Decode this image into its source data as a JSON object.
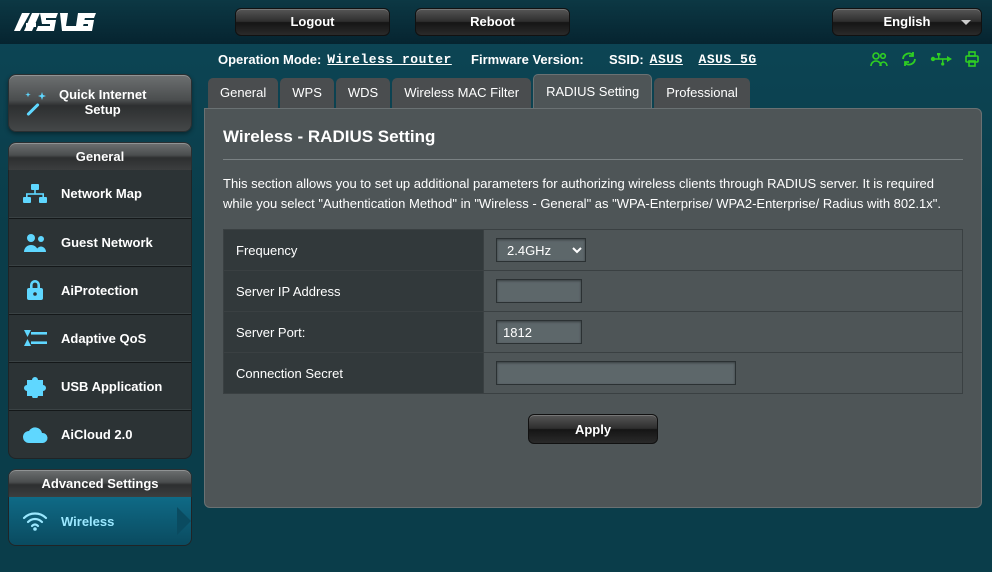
{
  "brand": "ASUS",
  "topbar": {
    "logout": "Logout",
    "reboot": "Reboot",
    "language": "English"
  },
  "status": {
    "op_mode_label": "Operation Mode:",
    "op_mode_value": "Wireless router",
    "fw_label": "Firmware Version:",
    "fw_value": "",
    "ssid_label": "SSID:",
    "ssid1": "ASUS",
    "ssid2": "ASUS_5G"
  },
  "sidebar": {
    "quick": {
      "line1": "Quick Internet",
      "line2": "Setup"
    },
    "general_header": "General",
    "general_items": [
      {
        "label": "Network Map"
      },
      {
        "label": "Guest Network"
      },
      {
        "label": "AiProtection"
      },
      {
        "label": "Adaptive QoS"
      },
      {
        "label": "USB Application"
      },
      {
        "label": "AiCloud 2.0"
      }
    ],
    "advanced_header": "Advanced Settings",
    "advanced_items": [
      {
        "label": "Wireless",
        "active": true
      }
    ]
  },
  "tabs": [
    {
      "label": "General"
    },
    {
      "label": "WPS"
    },
    {
      "label": "WDS"
    },
    {
      "label": "Wireless MAC Filter"
    },
    {
      "label": "RADIUS Setting",
      "active": true
    },
    {
      "label": "Professional"
    }
  ],
  "page": {
    "title": "Wireless - RADIUS Setting",
    "description": "This section allows you to set up additional parameters for authorizing wireless clients through RADIUS server. It is required while you select \"Authentication Method\" in \"Wireless - General\" as \"WPA-Enterprise/ WPA2-Enterprise/ Radius with 802.1x\".",
    "fields": {
      "frequency": {
        "label": "Frequency",
        "value": "2.4GHz"
      },
      "server_ip": {
        "label": "Server IP Address",
        "value": ""
      },
      "server_port": {
        "label": "Server Port:",
        "value": "1812"
      },
      "secret": {
        "label": "Connection Secret",
        "value": ""
      }
    },
    "apply": "Apply"
  },
  "colors": {
    "accent": "#5fd7ff",
    "ok": "#2fcf22"
  }
}
